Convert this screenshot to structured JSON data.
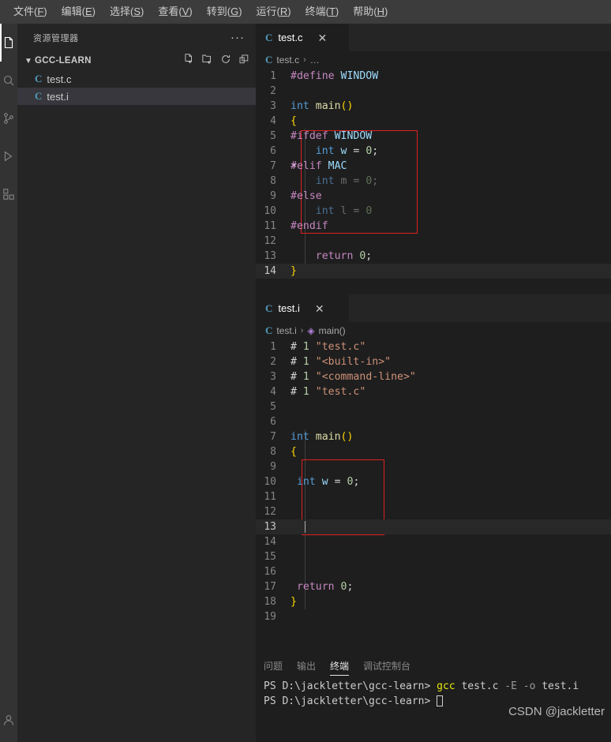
{
  "menubar": {
    "items": [
      {
        "label": "文件",
        "mnemonic": "F"
      },
      {
        "label": "编辑",
        "mnemonic": "E"
      },
      {
        "label": "选择",
        "mnemonic": "S"
      },
      {
        "label": "查看",
        "mnemonic": "V"
      },
      {
        "label": "转到",
        "mnemonic": "G"
      },
      {
        "label": "运行",
        "mnemonic": "R"
      },
      {
        "label": "终端",
        "mnemonic": "T"
      },
      {
        "label": "帮助",
        "mnemonic": "H"
      }
    ]
  },
  "activitybar": {
    "items": [
      {
        "name": "explorer-icon",
        "active": true
      },
      {
        "name": "search-icon",
        "active": false
      },
      {
        "name": "source-control-icon",
        "active": false
      },
      {
        "name": "run-and-debug-icon",
        "active": false
      },
      {
        "name": "extensions-icon",
        "active": false
      }
    ],
    "bottom": [
      {
        "name": "accounts-icon"
      }
    ]
  },
  "sidebar": {
    "title": "资源管理器",
    "more_actions": "···",
    "tree": {
      "root_label": "GCC-LEARN",
      "expanded": true,
      "actions": [
        "new-file-icon",
        "new-folder-icon",
        "refresh-icon",
        "collapse-all-icon"
      ],
      "files": [
        {
          "name": "test.c",
          "icon": "C",
          "selected": false
        },
        {
          "name": "test.i",
          "icon": "C",
          "selected": true
        }
      ]
    }
  },
  "editor_top": {
    "tab": {
      "icon": "C",
      "label": "test.c",
      "close": "✕"
    },
    "breadcrumb": {
      "icon": "C",
      "file": "test.c",
      "sep": "›",
      "rest": "…"
    },
    "lines": [
      {
        "n": 1,
        "tokens": [
          {
            "t": "#define ",
            "c": "g-pre"
          },
          {
            "t": "WINDOW",
            "c": "g-macro"
          }
        ],
        "indent": 0
      },
      {
        "n": 2,
        "tokens": [],
        "indent": 0
      },
      {
        "n": 3,
        "tokens": [
          {
            "t": "int ",
            "c": "g-kw"
          },
          {
            "t": "main",
            "c": "g-fn"
          },
          {
            "t": "()",
            "c": "g-y"
          }
        ],
        "indent": 0
      },
      {
        "n": 4,
        "tokens": [
          {
            "t": "{",
            "c": "g-y"
          }
        ],
        "indent": 0
      },
      {
        "n": 5,
        "tokens": [
          {
            "t": "#ifdef ",
            "c": "g-pre"
          },
          {
            "t": "WINDOW",
            "c": "g-macro"
          }
        ],
        "indent": 0
      },
      {
        "n": 6,
        "tokens": [
          {
            "t": "    ",
            "c": "g-op"
          },
          {
            "t": "int ",
            "c": "g-kw"
          },
          {
            "t": "w ",
            "c": "g-var"
          },
          {
            "t": "= ",
            "c": "g-op"
          },
          {
            "t": "0",
            "c": "g-num"
          },
          {
            "t": ";",
            "c": "g-op"
          }
        ],
        "indent": 0
      },
      {
        "n": 7,
        "tokens": [
          {
            "t": "#elif ",
            "c": "g-pre"
          },
          {
            "t": "MAC",
            "c": "g-macro"
          }
        ],
        "indent": 0,
        "fold": true
      },
      {
        "n": 8,
        "tokens": [
          {
            "t": "    ",
            "c": "g-op"
          },
          {
            "t": "int ",
            "c": "g-dimkw"
          },
          {
            "t": "m ",
            "c": "g-dim"
          },
          {
            "t": "= ",
            "c": "g-dim"
          },
          {
            "t": "0",
            "c": "g-dimnum"
          },
          {
            "t": ";",
            "c": "g-dim"
          }
        ],
        "indent": 0
      },
      {
        "n": 9,
        "tokens": [
          {
            "t": "#else",
            "c": "g-pre"
          }
        ],
        "indent": 0
      },
      {
        "n": 10,
        "tokens": [
          {
            "t": "    ",
            "c": "g-op"
          },
          {
            "t": "int ",
            "c": "g-dimkw"
          },
          {
            "t": "l ",
            "c": "g-dim"
          },
          {
            "t": "= ",
            "c": "g-dim"
          },
          {
            "t": "0",
            "c": "g-dimnum"
          }
        ],
        "indent": 0
      },
      {
        "n": 11,
        "tokens": [
          {
            "t": "#endif",
            "c": "g-pre"
          }
        ],
        "indent": 0
      },
      {
        "n": 12,
        "tokens": [],
        "indent": 0
      },
      {
        "n": 13,
        "tokens": [
          {
            "t": "    ",
            "c": "g-op"
          },
          {
            "t": "return ",
            "c": "g-pre"
          },
          {
            "t": "0",
            "c": "g-num"
          },
          {
            "t": ";",
            "c": "g-op"
          }
        ],
        "indent": 0
      },
      {
        "n": 14,
        "tokens": [
          {
            "t": "}",
            "c": "g-y"
          }
        ],
        "indent": 0,
        "current": true
      }
    ]
  },
  "editor_bottom": {
    "tab": {
      "icon": "C",
      "label": "test.i",
      "close": "✕"
    },
    "breadcrumb": {
      "icon": "C",
      "file": "test.i",
      "sep": "›",
      "symbol": "main()"
    },
    "lines": [
      {
        "n": 1,
        "tokens": [
          {
            "t": "# ",
            "c": "g-op"
          },
          {
            "t": "1",
            "c": "g-num"
          },
          {
            "t": " ",
            "c": "g-op"
          },
          {
            "t": "\"test.c\"",
            "c": "g-str"
          }
        ]
      },
      {
        "n": 2,
        "tokens": [
          {
            "t": "# ",
            "c": "g-op"
          },
          {
            "t": "1",
            "c": "g-num"
          },
          {
            "t": " ",
            "c": "g-op"
          },
          {
            "t": "\"<built-in>\"",
            "c": "g-str"
          }
        ]
      },
      {
        "n": 3,
        "tokens": [
          {
            "t": "# ",
            "c": "g-op"
          },
          {
            "t": "1",
            "c": "g-num"
          },
          {
            "t": " ",
            "c": "g-op"
          },
          {
            "t": "\"<command-line>\"",
            "c": "g-str"
          }
        ]
      },
      {
        "n": 4,
        "tokens": [
          {
            "t": "# ",
            "c": "g-op"
          },
          {
            "t": "1",
            "c": "g-num"
          },
          {
            "t": " ",
            "c": "g-op"
          },
          {
            "t": "\"test.c\"",
            "c": "g-str"
          }
        ]
      },
      {
        "n": 5,
        "tokens": []
      },
      {
        "n": 6,
        "tokens": []
      },
      {
        "n": 7,
        "tokens": [
          {
            "t": "int ",
            "c": "g-kw"
          },
          {
            "t": "main",
            "c": "g-fn"
          },
          {
            "t": "()",
            "c": "g-y"
          }
        ]
      },
      {
        "n": 8,
        "tokens": [
          {
            "t": "{",
            "c": "g-y"
          }
        ]
      },
      {
        "n": 9,
        "tokens": []
      },
      {
        "n": 10,
        "tokens": [
          {
            "t": " ",
            "c": "g-op"
          },
          {
            "t": "int ",
            "c": "g-kw"
          },
          {
            "t": "w ",
            "c": "g-var"
          },
          {
            "t": "= ",
            "c": "g-op"
          },
          {
            "t": "0",
            "c": "g-num"
          },
          {
            "t": ";",
            "c": "g-op"
          }
        ]
      },
      {
        "n": 11,
        "tokens": []
      },
      {
        "n": 12,
        "tokens": []
      },
      {
        "n": 13,
        "tokens": [],
        "current": true
      },
      {
        "n": 14,
        "tokens": []
      },
      {
        "n": 15,
        "tokens": []
      },
      {
        "n": 16,
        "tokens": []
      },
      {
        "n": 17,
        "tokens": [
          {
            "t": " ",
            "c": "g-op"
          },
          {
            "t": "return ",
            "c": "g-pre"
          },
          {
            "t": "0",
            "c": "g-num"
          },
          {
            "t": ";",
            "c": "g-op"
          }
        ]
      },
      {
        "n": 18,
        "tokens": [
          {
            "t": "}",
            "c": "g-y"
          }
        ]
      },
      {
        "n": 19,
        "tokens": []
      }
    ]
  },
  "panel": {
    "tabs": [
      {
        "label": "问题",
        "active": false
      },
      {
        "label": "输出",
        "active": false
      },
      {
        "label": "终端",
        "active": true
      },
      {
        "label": "调试控制台",
        "active": false
      }
    ],
    "terminal": {
      "line1_prompt": "PS D:\\jackletter\\gcc-learn>",
      "line1_cmd": "gcc",
      "line1_arg1": " test.c ",
      "line1_flag1": "-E",
      "line1_flag2": " -o ",
      "line1_arg2": "test.i",
      "line2_prompt": "PS D:\\jackletter\\gcc-learn>"
    }
  },
  "watermark": "CSDN @jackletter"
}
